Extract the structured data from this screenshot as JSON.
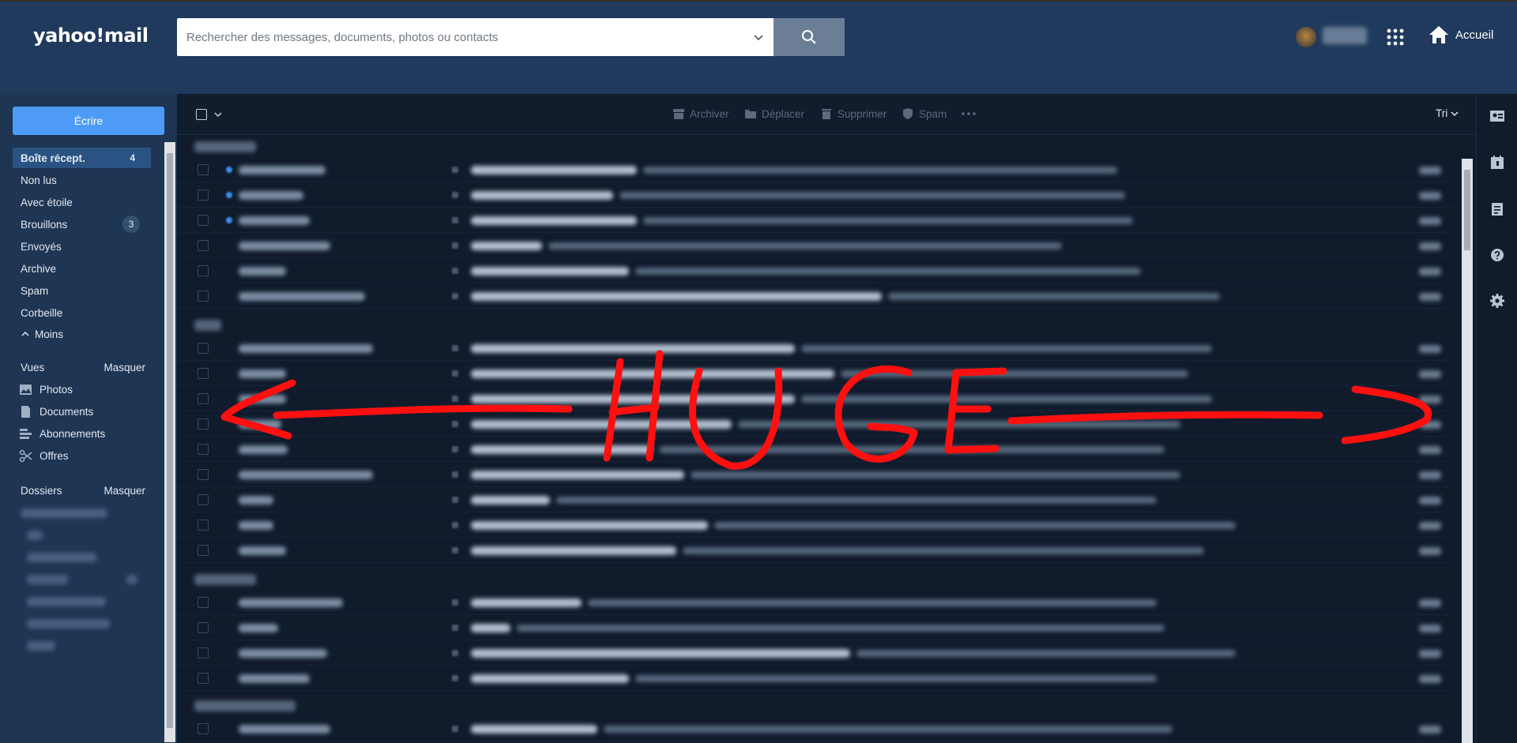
{
  "app": {
    "logo_text": "yahoo!mail"
  },
  "search": {
    "placeholder": "Rechercher des messages, documents, photos ou contacts"
  },
  "header": {
    "home_label": "Accueil"
  },
  "compose_label": "Écrire",
  "folders": [
    {
      "label": "Boîte récept.",
      "count": "4",
      "active": true
    },
    {
      "label": "Non lus"
    },
    {
      "label": "Avec étoile"
    },
    {
      "label": "Brouillons",
      "count": "3"
    },
    {
      "label": "Envoyés"
    },
    {
      "label": "Archive"
    },
    {
      "label": "Spam"
    },
    {
      "label": "Corbeille"
    }
  ],
  "less_label": "Moins",
  "views": {
    "title": "Vues",
    "hide_label": "Masquer",
    "items": [
      {
        "label": "Photos",
        "icon": "photo-icon"
      },
      {
        "label": "Documents",
        "icon": "document-icon"
      },
      {
        "label": "Abonnements",
        "icon": "subscriptions-icon"
      },
      {
        "label": "Offres",
        "icon": "scissors-icon"
      }
    ]
  },
  "dossiers": {
    "title": "Dossiers",
    "hide_label": "Masquer"
  },
  "toolbar": {
    "archive": "Archiver",
    "move": "Déplacer",
    "delete": "Supprimer",
    "spam": "Spam",
    "sort": "Tri"
  },
  "annotation": {
    "text": "HUGE",
    "color": "#ff1010"
  },
  "colors": {
    "header_bg": "#1f3a5c",
    "nav_bg": "#1e3553",
    "list_bg": "#101b2c",
    "accent": "#4d9bf7",
    "active_folder": "#2a5283"
  }
}
